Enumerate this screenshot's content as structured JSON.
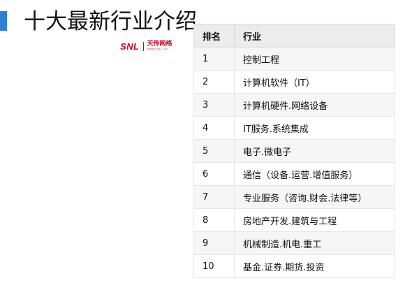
{
  "header": {
    "title": "十大最新行业介绍",
    "accent_color": "#2f7ed8"
  },
  "brand": {
    "letters": "SNL",
    "chinese": "天传网络",
    "subtitle": "WWW.SNL.CN",
    "color": "#d0021b"
  },
  "table": {
    "columns": [
      "排名",
      "行业"
    ],
    "rows": [
      {
        "rank": "1",
        "industry": "控制工程"
      },
      {
        "rank": "2",
        "industry": "计算机软件（IT）"
      },
      {
        "rank": "3",
        "industry": "计算机硬件.网络设备"
      },
      {
        "rank": "4",
        "industry": "IT服务.系统集成"
      },
      {
        "rank": "5",
        "industry": "电子.微电子"
      },
      {
        "rank": "6",
        "industry": "通信（设备.运营.增值服务）"
      },
      {
        "rank": "7",
        "industry": "专业服务（咨询.财会.法律等）"
      },
      {
        "rank": "8",
        "industry": "房地产开发.建筑与工程"
      },
      {
        "rank": "9",
        "industry": "机械制造.机电.重工"
      },
      {
        "rank": "10",
        "industry": "基金.证券.期货.投资"
      }
    ]
  }
}
